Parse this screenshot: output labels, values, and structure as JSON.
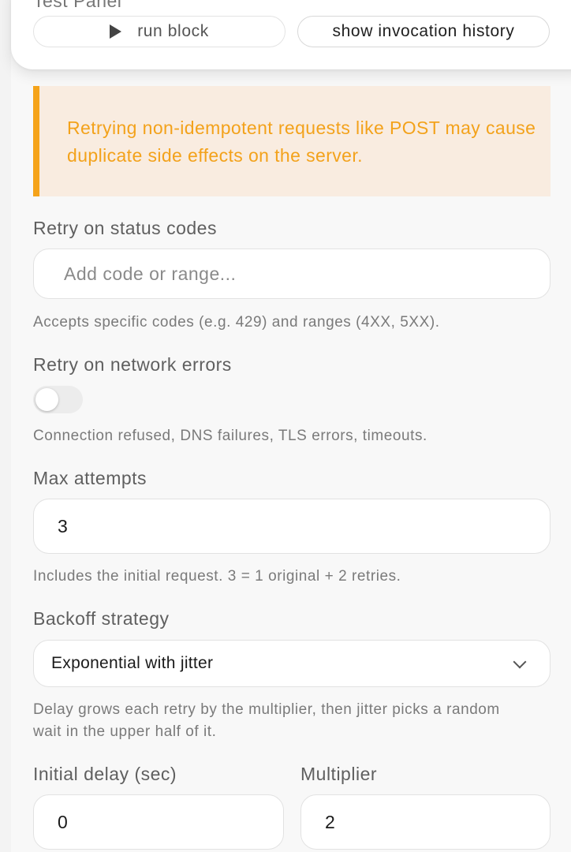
{
  "test_panel": {
    "title": "Test Panel",
    "run_label": "run block",
    "history_label": "show invocation history"
  },
  "warning": {
    "text": "Retrying non-idempotent requests like POST may cause duplicate side effects on the server.",
    "accent_color": "#f5a31a"
  },
  "status_codes": {
    "label": "Retry on status codes",
    "placeholder": "Add code or range...",
    "help": "Accepts specific codes (e.g. 429) and ranges (4XX, 5XX)."
  },
  "network_errors": {
    "label": "Retry on network errors",
    "enabled": false,
    "help": "Connection refused, DNS failures, TLS errors, timeouts."
  },
  "max_attempts": {
    "label": "Max attempts",
    "value": "3",
    "help": "Includes the initial request. 3 = 1 original + 2 retries."
  },
  "backoff": {
    "label": "Backoff strategy",
    "selected": "Exponential with jitter",
    "help": "Delay grows each retry by the multiplier, then jitter picks a random wait in the upper half of it."
  },
  "initial_delay": {
    "label": "Initial delay (sec)",
    "value": "0"
  },
  "multiplier": {
    "label": "Multiplier",
    "value": "2"
  }
}
